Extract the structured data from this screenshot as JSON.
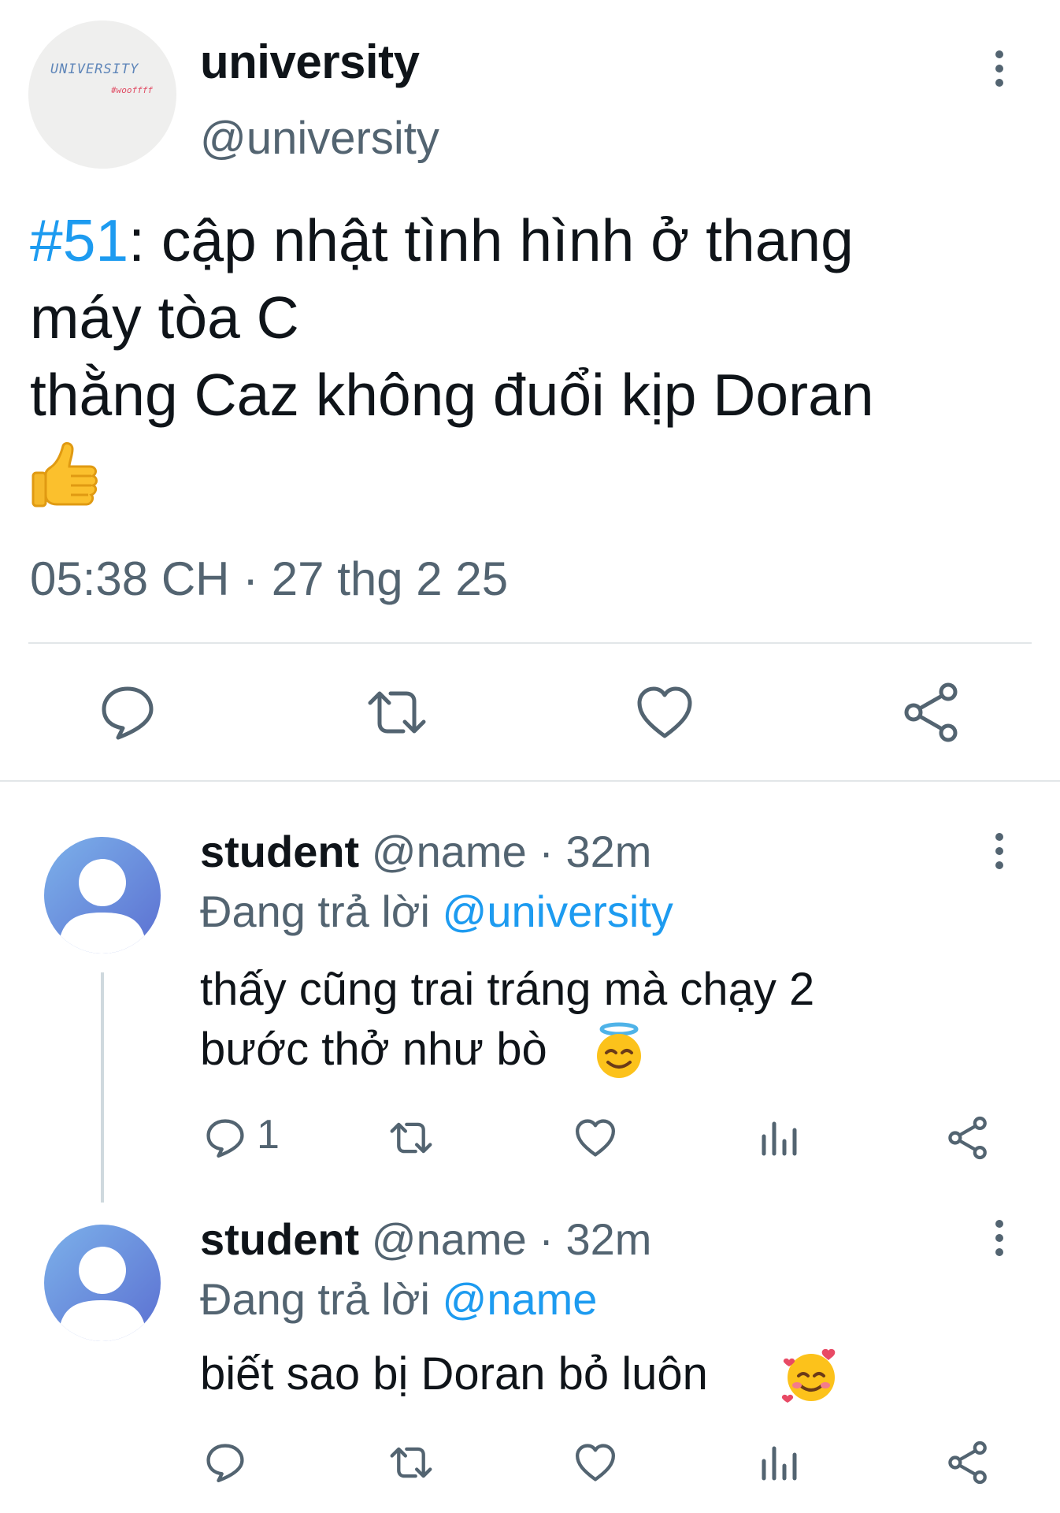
{
  "main_tweet": {
    "author_name": "university",
    "author_handle": "@university",
    "avatar_logo_text": "UNIVERSITY",
    "avatar_logo_sub": "#wooffff",
    "hashtag": "#51",
    "text": ": cập nhật tình hình ở thang\nmáy tòa C\nthằng Caz không đuổi kịp Doran",
    "emoji": "thumbs-up",
    "timestamp": "05:38 CH · 27 thg 2 25",
    "actions": [
      "reply-icon",
      "retweet-icon",
      "like-icon",
      "share-icon"
    ]
  },
  "replies": [
    {
      "author_name": "student",
      "handle_time": "@name · 32m",
      "replying_label": "Đang trả lời",
      "replying_to": "@university",
      "text": "thấy cũng trai tráng mà chạy 2\nbước thở như bò",
      "emoji": "smiling-face-with-halo",
      "reply_count": "1"
    },
    {
      "author_name": "student",
      "handle_time": "@name · 32m",
      "replying_label": "Đang trả lời",
      "replying_to": "@name",
      "text": "biết sao bị Doran bỏ luôn",
      "emoji": "smiling-face-with-hearts",
      "reply_count": ""
    }
  ],
  "colors": {
    "link": "#1d9bf0",
    "muted": "#536471",
    "avatar_gradient_start": "#7cb1ea",
    "avatar_gradient_end": "#5b6fd1"
  }
}
